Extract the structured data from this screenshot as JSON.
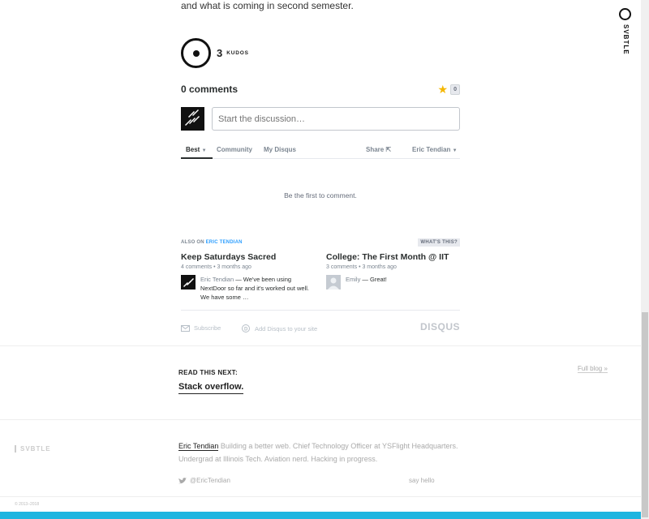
{
  "post": {
    "tail_text": "and what is coming in second semester.",
    "kudos_count": "3",
    "kudos_label": "KUDOS"
  },
  "disqus": {
    "comments_count": "0 comments",
    "star_count": "0",
    "placeholder": "Start the discussion…",
    "tabs": {
      "best": "Best",
      "community": "Community",
      "my_disqus": "My Disqus"
    },
    "share": "Share",
    "user": "Eric Tendian",
    "empty_note": "Be the first to comment.",
    "also_on": "ALSO ON",
    "also_site": "ERIC TENDIAN",
    "whats_this": "WHAT'S THIS?",
    "related": [
      {
        "title": "Keep Saturdays Sacred",
        "meta": "4 comments • 3 months ago",
        "author": "Eric Tendian",
        "comment": " — We've been using NextDoor so far and it's worked out well. We have some …"
      },
      {
        "title": "College: The First Month @ IIT",
        "meta": "3 comments • 3 months ago",
        "author": "Emily",
        "comment": " — Great!"
      }
    ],
    "subscribe": "Subscribe",
    "add_disqus": "Add Disqus to your site",
    "logo": "DISQUS"
  },
  "read_next": {
    "label": "READ THIS NEXT:",
    "title": "Stack overflow.",
    "full_blog": "Full blog »"
  },
  "footer": {
    "brand": "SVBTLE",
    "author_name": "Eric Tendian",
    "bio": " Building a better web. Chief Technology Officer at YSFlight Headquarters. Undergrad at Illinois Tech. Aviation nerd. Hacking in progress.",
    "twitter": "@EricTendian",
    "say_hello": "say hello",
    "copyright": "© 2013–2018"
  },
  "side_tab": {
    "label": "SVBTLE"
  },
  "colors": {
    "accent_bar": "#1eb5e0",
    "star": "#f5b700",
    "link_blue": "#2e9fff"
  }
}
